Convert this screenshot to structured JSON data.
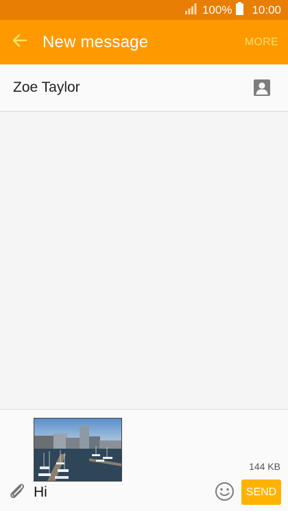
{
  "status_bar": {
    "signal_icon": "signal-icon",
    "battery_percent": "100%",
    "battery_icon": "battery-icon",
    "time": "10:00"
  },
  "app_bar": {
    "back_icon": "arrow-left-icon",
    "title": "New message",
    "more_label": "MORE"
  },
  "recipient": {
    "name": "Zoe Taylor",
    "contact_icon": "contact-icon"
  },
  "composer": {
    "attachment_icon": "paperclip-icon",
    "attachment_size": "144 KB",
    "message_value": "Hi",
    "emoji_icon": "smiley-icon",
    "send_label": "SEND"
  },
  "colors": {
    "status_bar": "#e87e04",
    "app_bar": "#ff9900",
    "more_text": "#ffe16b",
    "send_button": "#ffb300"
  }
}
